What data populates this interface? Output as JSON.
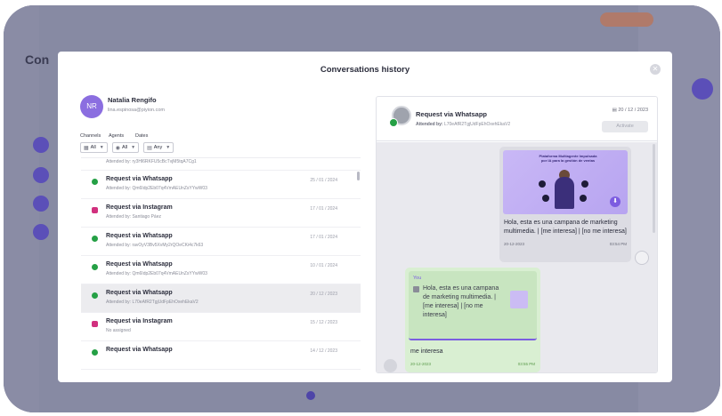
{
  "modal": {
    "title": "Conversations history",
    "close_icon": "close-icon"
  },
  "user": {
    "initials": "NR",
    "name": "Natalia Rengifo",
    "email": "lina.espinosa@piyion.com"
  },
  "filters": {
    "labels": [
      "Channels",
      "Agents",
      "Dates"
    ],
    "channels_value": "All",
    "agents_value": "All",
    "dates_value": "Any"
  },
  "list": {
    "first_partial_sub": "Attended by: ry3Hl6RKFU5cBcTvjM5tqA7Cg1",
    "items": [
      {
        "channel": "whatsapp",
        "title": "Request via Whatsapp",
        "sub": "Attended by: Qm6Idp2Eb07q4VmAEUnZsYYwW03",
        "date": "25 / 01 / 2024"
      },
      {
        "channel": "instagram",
        "title": "Request via Instagram",
        "sub": "Attended by: Santiago Páez",
        "date": "17 / 01 / 2024"
      },
      {
        "channel": "whatsapp",
        "title": "Request via Whatsapp",
        "sub": "Attended by: ravOyV3Bv5XvMy2rQOeCKi4c7k63",
        "date": "17 / 01 / 2024"
      },
      {
        "channel": "whatsapp",
        "title": "Request via Whatsapp",
        "sub": "Attended by: Qm6Idp2Eb07q4VmAEUnZsYYwW03",
        "date": "10 / 01 / 2024"
      },
      {
        "channel": "whatsapp",
        "title": "Request via Whatsapp",
        "sub": "Attended by: L70eAfR2TgjUdFpEhOxehEkaV2",
        "date": "20 / 12 / 2023"
      },
      {
        "channel": "instagram",
        "title": "Request via Instagram",
        "sub": "No assigned",
        "date": "15 / 12 / 2023"
      },
      {
        "channel": "whatsapp",
        "title": "Request via Whatsapp",
        "sub": "",
        "date": "14 / 12 / 2023"
      }
    ]
  },
  "chat": {
    "title": "Request via Whatsapp",
    "attended_label": "Attended by:",
    "attended_value": "L70eAfR2TgjUdFpEhOxehEkaV2",
    "date": "20 / 12 / 2023",
    "activate_label": "Activate",
    "promo_text": "Plataforma Multiagente Impulsada por IA para la gestión de ventas",
    "out_message": "Hola, esta es una campana de marketing multimedia. | [me interesa] | [no me interesa]",
    "out_date": "20-12-2023",
    "out_time": "03:54 PM",
    "quote_you": "You",
    "quote_text": "Hola, esta es una campana de marketing multimedia. | [me interesa] | [no me interesa]",
    "in_message": "me interesa",
    "in_date": "20-12-2023",
    "in_time": "03:55 PM"
  },
  "colors": {
    "accent": "#7b5ee0",
    "whatsapp": "#25a045",
    "instagram": "#d1307e"
  }
}
